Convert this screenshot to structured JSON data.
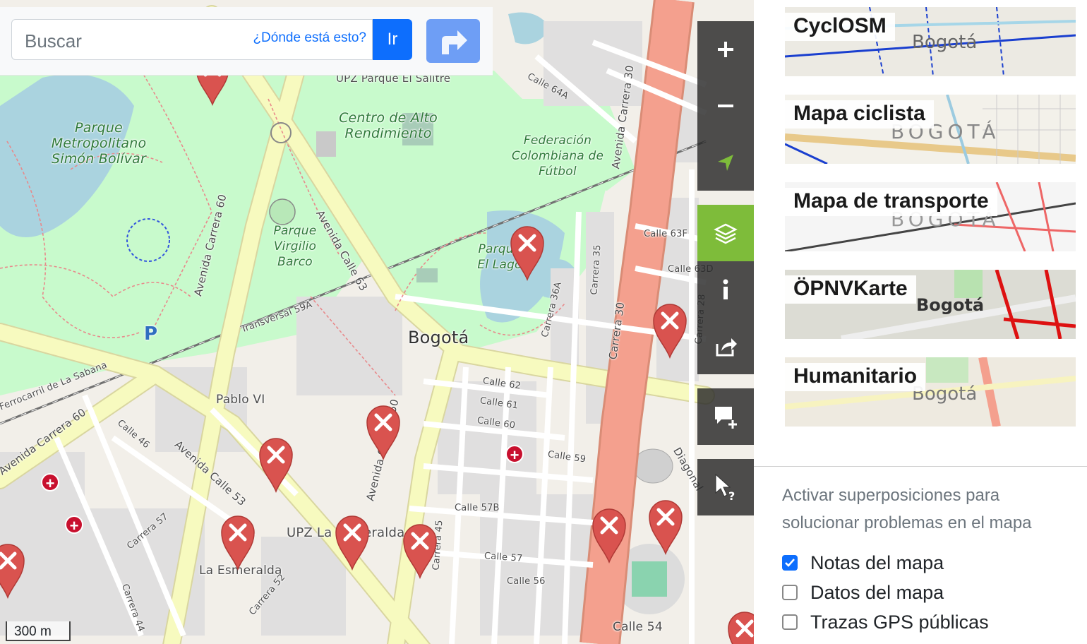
{
  "search": {
    "placeholder": "Buscar",
    "where_link": "¿Dónde está esto?",
    "go_label": "Ir"
  },
  "map": {
    "scale_label": "300 m",
    "labels": {
      "upz_parque_salitre": "UPZ Parque El Salitre",
      "centro_alto": "Centro de Alto Rendimiento",
      "federacion": "Federación Colombiana de Fútbol",
      "parque_simon": "Parque Metropolitano Simón Bolívar",
      "parque_virgilio": "Parque Virgilio Barco",
      "parque_lago": "Parque El Lago",
      "bogota": "Bogotá",
      "pablo_vi": "Pablo VI",
      "la_esmeralda": "La Esmeralda",
      "upz_esmeralda": "UPZ La Esmeralda",
      "av_carrera_60": "Avenida Carrera 60",
      "av_calle_63": "Avenida Calle 63",
      "av_calle_53": "Avenida Calle 53",
      "av_carrera_50": "Avenida Carrera 50",
      "av_carrera_30": "Avenida Carrera 30",
      "carrera_30": "Carrera 30",
      "carrera_60": "Avenida Carrera 60",
      "ferrocarril": "Ferrocarril de La Sabana",
      "transversal_59a": "Transversal 59A",
      "calle_64a": "Calle 64A",
      "calle_63f": "Calle 63F",
      "calle_63d": "Calle 63D",
      "calle_62": "Calle 62",
      "calle_61": "Calle 61",
      "calle_60": "Calle 60",
      "calle_59": "Calle 59",
      "calle_57b": "Calle 57B",
      "calle_57": "Calle 57",
      "calle_56": "Calle 56",
      "calle_54": "Calle 54",
      "calle_46": "Calle 46",
      "carrera_45": "Carrera 45",
      "carrera_36a": "Carrera 36A",
      "carrera_35": "Carrera 35",
      "carrera_28": "Carrera 28",
      "carrera_57": "Carrera 57",
      "carrera_52": "Carrera 52",
      "carrera_44": "Carrera 44",
      "diagonal": "Diagonal",
      "el_salitre": "El Salitre"
    }
  },
  "controls": {
    "zoom_in_icon": "plus-icon",
    "zoom_out_icon": "minus-icon",
    "locate_icon": "location-arrow-icon",
    "layers_icon": "layers-icon",
    "info_icon": "info-icon",
    "share_icon": "share-icon",
    "note_icon": "add-note-icon",
    "query_icon": "query-cursor-icon"
  },
  "layers": [
    {
      "name": "CyclOSM",
      "thumb_text": "Bogotá"
    },
    {
      "name": "Mapa ciclista",
      "thumb_text": "BOGOTÁ"
    },
    {
      "name": "Mapa de transporte",
      "thumb_text": "BOGOTÁ"
    },
    {
      "name": "ÖPNVKarte",
      "thumb_text": "Bogotá"
    },
    {
      "name": "Humanitario",
      "thumb_text": "Bogotá"
    }
  ],
  "overlays": {
    "description": "Activar superposiciones para solucionar problemas en el mapa",
    "items": [
      {
        "label": "Notas del mapa",
        "checked": true
      },
      {
        "label": "Datos del mapa",
        "checked": false
      },
      {
        "label": "Trazas GPS públicas",
        "checked": false
      }
    ]
  },
  "colors": {
    "primary": "#0d6efd",
    "active_layer": "#7ebc3a",
    "primary_road": "#f4a08e",
    "secondary_road": "#f7fabf",
    "park": "#c8facc",
    "water": "#aad3df",
    "note_pin": "#d9534f"
  }
}
